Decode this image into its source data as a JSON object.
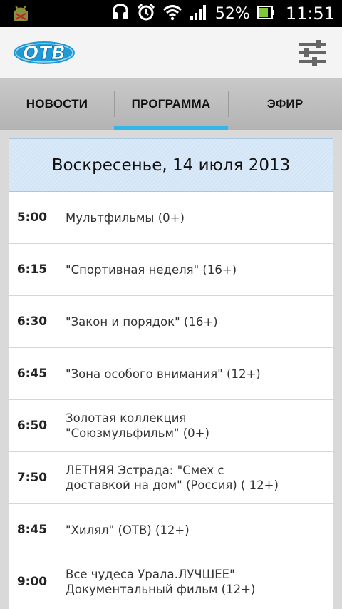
{
  "status_bar": {
    "battery_percent": "52%",
    "time": "11:51",
    "icons": [
      "android-debug-icon",
      "headset-icon",
      "alarm-icon",
      "wifi-icon",
      "signal-icon",
      "battery-icon"
    ]
  },
  "app_bar": {
    "logo_text": "ОТВ",
    "settings_icon": "sliders-icon"
  },
  "tabs": [
    {
      "label": "НОВОСТИ",
      "active": false
    },
    {
      "label": "ПРОГРАММА",
      "active": true
    },
    {
      "label": "ЭФИР",
      "active": false
    }
  ],
  "colors": {
    "accent": "#33b5e5",
    "logo_blue": "#1e9bd7",
    "header_bg": "#dbeaf8"
  },
  "schedule": {
    "day": "Воскресенье, 14 июля 2013",
    "rows": [
      {
        "time": "5:00",
        "title": "Мультфильмы (0+)"
      },
      {
        "time": "6:15",
        "title": "\"Спортивная неделя\" (16+)"
      },
      {
        "time": "6:30",
        "title": "\"Закон и порядок\" (16+)"
      },
      {
        "time": "6:45",
        "title": "\"Зона особого внимания\" (12+)"
      },
      {
        "time": "6:50",
        "title": "Золотая коллекция\n\"Союзмульфильм\" (0+)"
      },
      {
        "time": "7:50",
        "title": "ЛЕТНЯЯ Эстрада: \"Смех с\nдоставкой на дом\" (Россия) ( 12+)"
      },
      {
        "time": "8:45",
        "title": "\"Хилял\" (ОТВ) (12+)"
      },
      {
        "time": "9:00",
        "title": "Все чудеса Урала.ЛУЧШЕЕ\"\nДокументальный фильм (12+)"
      }
    ]
  }
}
